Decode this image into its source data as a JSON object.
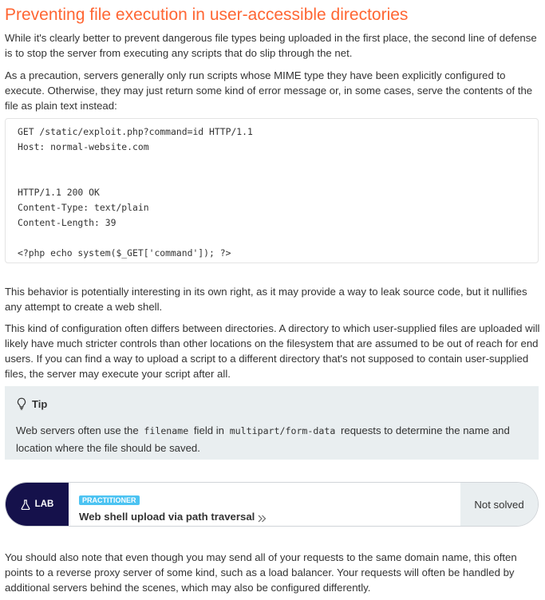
{
  "section_title": "Preventing file execution in user-accessible directories",
  "paragraphs": {
    "intro": "While it's clearly better to prevent dangerous file types being uploaded in the first place, the second line of defense is to stop the server from executing any scripts that do slip through the net.",
    "precaution": "As a precaution, servers generally only run scripts whose MIME type they have been explicitly configured to execute. Otherwise, they may just return some kind of error message or, in some cases, serve the contents of the file as plain text instead:",
    "behavior": "This behavior is potentially interesting in its own right, as it may provide a way to leak source code, but it nullifies any attempt to create a web shell.",
    "configuration": "This kind of configuration often differs between directories. A directory to which user-supplied files are uploaded will likely have much stricter controls than other locations on the filesystem that are assumed to be out of reach for end users. If you can find a way to upload a script to a different directory that's not supposed to contain user-supplied files, the server may execute your script after all.",
    "proxy_note": "You should also note that even though you may send all of your requests to the same domain name, this often points to a reverse proxy server of some kind, such as a load balancer. Your requests will often be handled by additional servers behind the scenes, which may also be configured differently."
  },
  "code_block": {
    "lines": [
      "GET /static/exploit.php?command=id HTTP/1.1",
      "Host: normal-website.com",
      "",
      "",
      "HTTP/1.1 200 OK",
      "Content-Type: text/plain",
      "Content-Length: 39",
      "",
      "<?php echo system($_GET['command']); ?>"
    ]
  },
  "tip": {
    "icon": "lightbulb-icon",
    "title": "Tip",
    "text_before": "Web servers often use the",
    "code1": "filename",
    "text_middle": "field in",
    "code2": "multipart/form-data",
    "text_after": "requests to determine the name and location where the file should be saved."
  },
  "lab": {
    "badge_label": "LAB",
    "badge_icon": "flask-icon",
    "level": "PRACTITIONER",
    "title": "Web shell upload via path traversal",
    "status": "Not solved"
  },
  "colors": {
    "title": "#ff6633",
    "text": "#333333",
    "tip_background": "#e9eef0",
    "lab_badge": "#15114b",
    "level_badge": "#4cc3f2"
  }
}
